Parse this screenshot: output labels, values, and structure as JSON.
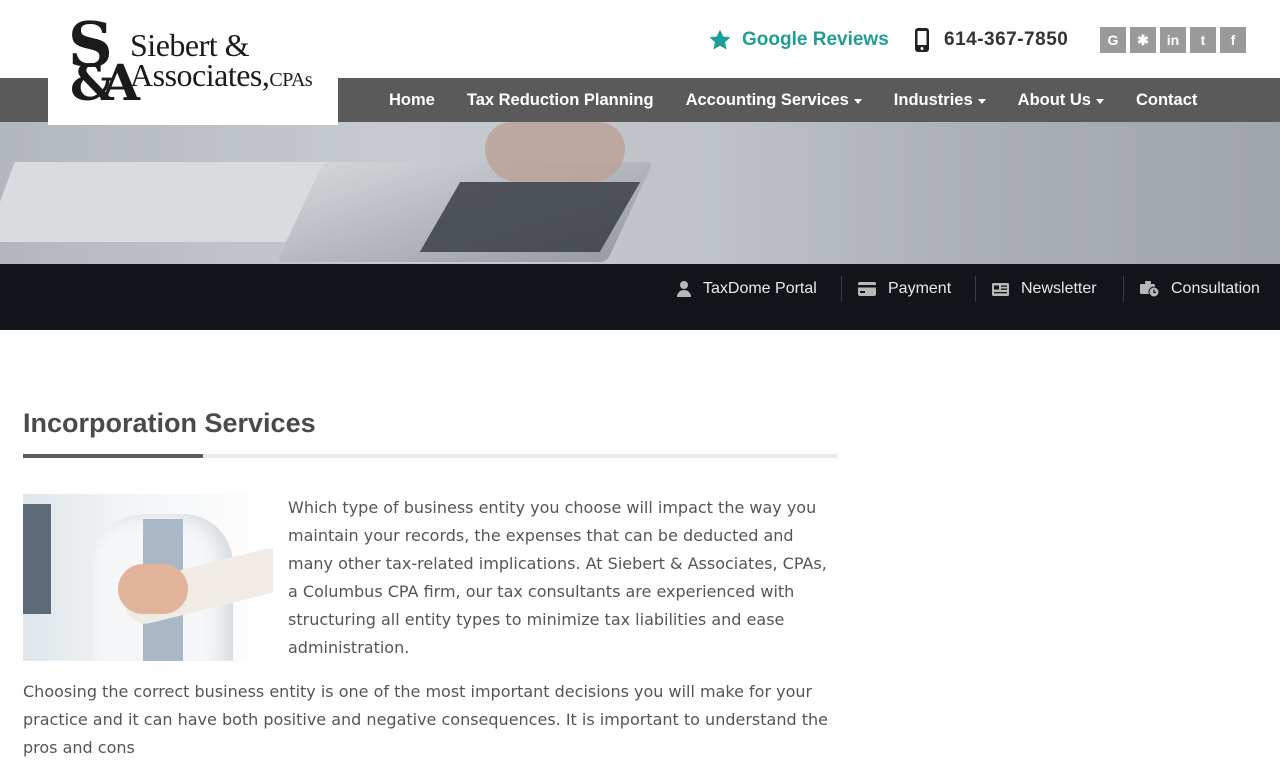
{
  "brand": {
    "logo_monogram_top": "S",
    "logo_monogram_bottom": "&A",
    "logo_line1": "Siebert &",
    "logo_line2": "Associates,",
    "logo_cpas": "CPAs"
  },
  "header": {
    "reviews_icon": "star-icon",
    "reviews_label": "Google Reviews",
    "phone_icon": "mobile-phone-icon",
    "phone_number": "614-367-7850",
    "accent_color": "#1f9e95",
    "social": [
      {
        "icon": "google-icon",
        "glyph": "G"
      },
      {
        "icon": "yelp-icon",
        "glyph": "✱"
      },
      {
        "icon": "linkedin-icon",
        "glyph": "in"
      },
      {
        "icon": "twitter-icon",
        "glyph": "t"
      },
      {
        "icon": "facebook-icon",
        "glyph": "f"
      }
    ]
  },
  "nav": {
    "items": [
      {
        "label": "Home",
        "dropdown": false
      },
      {
        "label": "Tax Reduction Planning",
        "dropdown": false
      },
      {
        "label": "Accounting Services",
        "dropdown": true
      },
      {
        "label": "Industries",
        "dropdown": true
      },
      {
        "label": "About Us",
        "dropdown": true
      },
      {
        "label": "Contact",
        "dropdown": false
      }
    ]
  },
  "utility": {
    "items": [
      {
        "label": "TaxDome Portal",
        "icon": "user-icon"
      },
      {
        "label": "Payment",
        "icon": "credit-card-icon"
      },
      {
        "label": "Newsletter",
        "icon": "newspaper-icon"
      },
      {
        "label": "Consultation",
        "icon": "business-time-icon"
      }
    ]
  },
  "content": {
    "title": "Incorporation Services",
    "paragraph1": "Which type of business entity you choose will impact the way you maintain your records, the expenses that can be deducted and many other tax-related implications. At Siebert & Associates, CPAs, a Columbus CPA firm, our tax consultants are experienced with structuring all entity types to minimize tax liabilities and ease administration.",
    "paragraph2": "Choosing the correct business entity is one of the most important decisions you will make for your practice and it can have both positive and negative consequences. It is important to understand the pros and cons"
  }
}
